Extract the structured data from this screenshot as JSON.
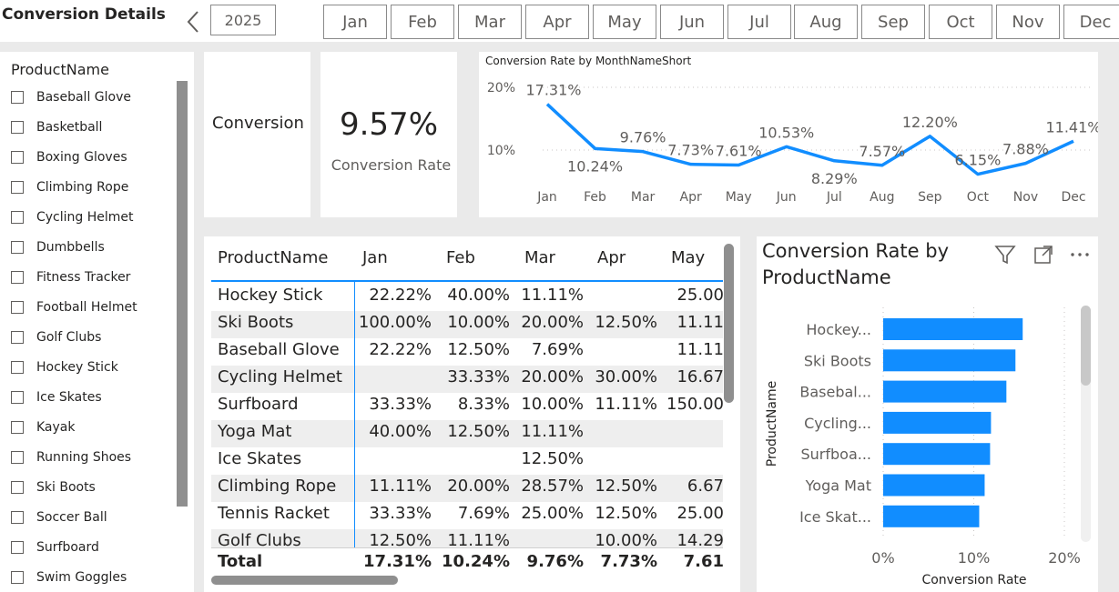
{
  "header": {
    "title": "Conversion Details",
    "year": "2025",
    "months": [
      "Jan",
      "Feb",
      "Mar",
      "Apr",
      "May",
      "Jun",
      "Jul",
      "Aug",
      "Sep",
      "Oct",
      "Nov",
      "Dec"
    ]
  },
  "slicer": {
    "title": "ProductName",
    "items": [
      "Baseball Glove",
      "Basketball",
      "Boxing Gloves",
      "Climbing Rope",
      "Cycling Helmet",
      "Dumbbells",
      "Fitness Tracker",
      "Football Helmet",
      "Golf Clubs",
      "Hockey Stick",
      "Ice Skates",
      "Kayak",
      "Running Shoes",
      "Ski Boots",
      "Soccer Ball",
      "Surfboard",
      "Swim Goggles"
    ]
  },
  "cards": {
    "label": "Conversion",
    "value": "9.57%",
    "value_caption": "Conversion Rate"
  },
  "table": {
    "headers": [
      "ProductName",
      "Jan",
      "Feb",
      "Mar",
      "Apr",
      "May"
    ],
    "rows": [
      [
        "Hockey Stick",
        "22.22%",
        "40.00%",
        "11.11%",
        "",
        "25.00"
      ],
      [
        "Ski Boots",
        "100.00%",
        "10.00%",
        "20.00%",
        "12.50%",
        "11.11"
      ],
      [
        "Baseball Glove",
        "22.22%",
        "12.50%",
        "7.69%",
        "",
        "11.11"
      ],
      [
        "Cycling Helmet",
        "",
        "33.33%",
        "20.00%",
        "30.00%",
        "16.67"
      ],
      [
        "Surfboard",
        "33.33%",
        "8.33%",
        "10.00%",
        "11.11%",
        "150.00"
      ],
      [
        "Yoga Mat",
        "40.00%",
        "12.50%",
        "11.11%",
        "",
        ""
      ],
      [
        "Ice Skates",
        "",
        "",
        "12.50%",
        "",
        ""
      ],
      [
        "Climbing Rope",
        "11.11%",
        "20.00%",
        "28.57%",
        "12.50%",
        "6.67"
      ],
      [
        "Tennis Racket",
        "33.33%",
        "7.69%",
        "25.00%",
        "12.50%",
        "25.00"
      ],
      [
        "Golf Clubs",
        "12.50%",
        "11.11%",
        "",
        "10.00%",
        "14.29"
      ]
    ],
    "total": [
      "Total",
      "17.31%",
      "10.24%",
      "9.76%",
      "7.73%",
      "7.61"
    ]
  },
  "chart_data": [
    {
      "type": "line",
      "title": "Conversion Rate by MonthNameShort",
      "categories": [
        "Jan",
        "Feb",
        "Mar",
        "Apr",
        "May",
        "Jun",
        "Jul",
        "Aug",
        "Sep",
        "Oct",
        "Nov",
        "Dec"
      ],
      "values": [
        17.31,
        10.24,
        9.76,
        7.73,
        7.61,
        10.53,
        8.29,
        7.57,
        12.2,
        6.15,
        7.88,
        11.41
      ],
      "labels": [
        "17.31%",
        "10.24%",
        "9.76%",
        "7.73%",
        "7.61%",
        "10.53%",
        "8.29%",
        "7.57%",
        "12.20%",
        "6.15%",
        "7.88%",
        "11.41%"
      ],
      "y_ticks": [
        "20%",
        "10%"
      ],
      "ylim": [
        0,
        20
      ],
      "color": "#118dff",
      "grid": true
    },
    {
      "type": "bar",
      "orientation": "horizontal",
      "title": "Conversion Rate by ProductName",
      "xlabel": "Conversion Rate",
      "ylabel": "ProductName",
      "categories": [
        "Hockey...",
        "Ski Boots",
        "Basebal...",
        "Cycling...",
        "Surfboa...",
        "Yoga Mat",
        "Ice Skat..."
      ],
      "values": [
        15.4,
        14.6,
        13.6,
        11.9,
        11.8,
        11.2,
        10.6
      ],
      "x_ticks": [
        "0%",
        "10%",
        "20%"
      ],
      "xlim": [
        0,
        20
      ],
      "color": "#118dff",
      "grid": true
    }
  ]
}
